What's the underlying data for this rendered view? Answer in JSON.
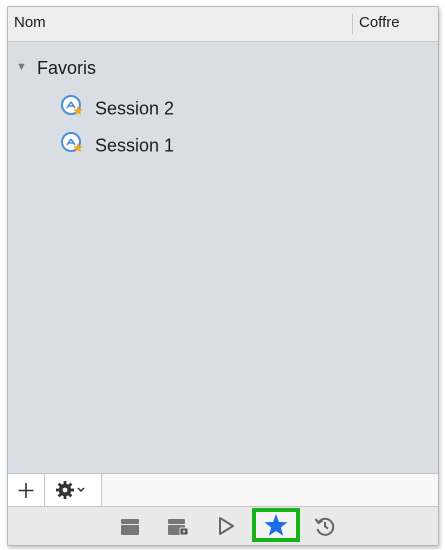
{
  "columns": {
    "name": "Nom",
    "vault": "Coffre"
  },
  "tree": {
    "group": {
      "label": "Favoris",
      "expanded": true,
      "disclosure_icon": "triangle-down-icon"
    },
    "sessions": [
      {
        "label": "Session 2",
        "icon": "remote-session-favorite-icon"
      },
      {
        "label": "Session 1",
        "icon": "remote-session-favorite-icon"
      }
    ]
  },
  "actionbar": {
    "add_icon": "plus-icon",
    "settings_icon": "gear-icon",
    "settings_menu_icon": "chevron-down-icon"
  },
  "toolbar": {
    "buttons": [
      {
        "icon": "open-session-icon"
      },
      {
        "icon": "open-vault-session-icon"
      },
      {
        "icon": "play-icon"
      },
      {
        "icon": "star-icon",
        "highlighted": true
      },
      {
        "icon": "history-icon"
      }
    ]
  },
  "colors": {
    "tree_background": "#d9dee5",
    "star": "#1a6fe8",
    "highlight_border": "#1ab21a",
    "session_icon_blue": "#4a8fd8",
    "session_icon_star": "#f2a81d"
  }
}
